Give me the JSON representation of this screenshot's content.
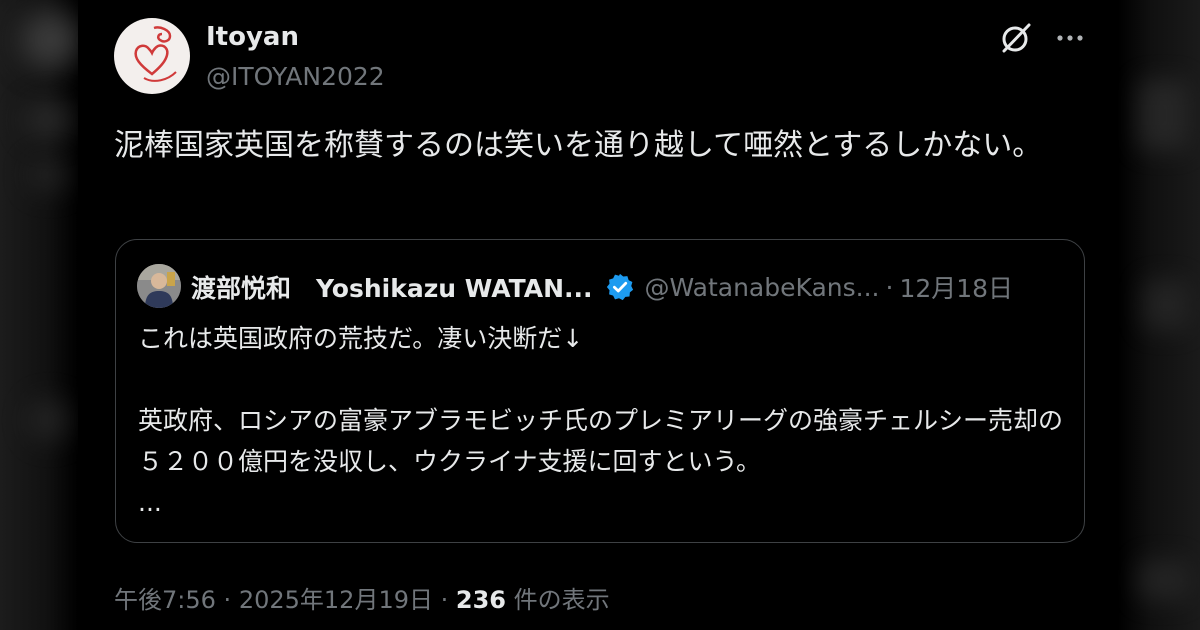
{
  "tweet": {
    "author_name": "Itoyan",
    "author_handle": "@ITOYAN2022",
    "text": "泥棒国家英国を称賛するのは笑いを通り越して唖然とするしかない。",
    "time": "午後7:56",
    "separator": "·",
    "date": "2025年12月19日",
    "views_count": "236",
    "views_label": "件の表示"
  },
  "quoted": {
    "author_name": "渡部悦和　Yoshikazu WATAN...",
    "author_handle": "@WatanabeKans...",
    "separator": "·",
    "date": "12月18日",
    "line1": "これは英国政府の荒技だ。凄い決断だ↓",
    "line2": "英政府、ロシアの富豪アブラモビッチ氏のプレミアリーグの強豪チェルシー売却の５２００億円を没収し、ウクライナ支援に回すという。",
    "ellipsis": "..."
  },
  "icons": {
    "grok": "grok-icon",
    "more": "more-icon",
    "verified": "verified-badge-icon"
  },
  "colors": {
    "background": "#000000",
    "text_primary": "#e7e9ea",
    "text_secondary": "#71767b",
    "border": "#3e4144",
    "verified": "#1d9bf0"
  }
}
